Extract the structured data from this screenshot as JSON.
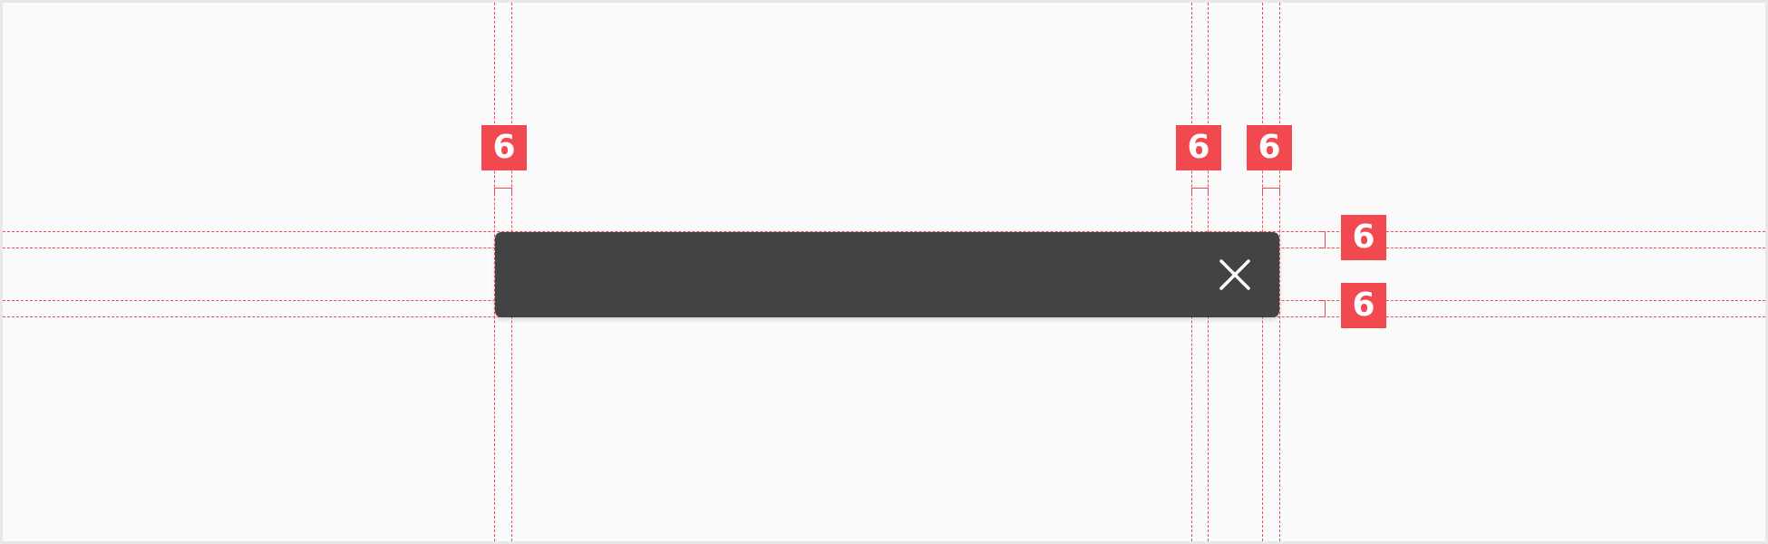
{
  "colors": {
    "background": "#fafafa",
    "guide": "#ef4b52",
    "badge": "#f24950",
    "snackbar": "#434343",
    "icon": "#ffffff"
  },
  "snackbar": {
    "close_icon": "close-icon"
  },
  "annotations": {
    "left_padding": "6",
    "icon_left_padding": "6",
    "icon_right_padding": "6",
    "top_padding": "6",
    "bottom_padding": "6"
  }
}
